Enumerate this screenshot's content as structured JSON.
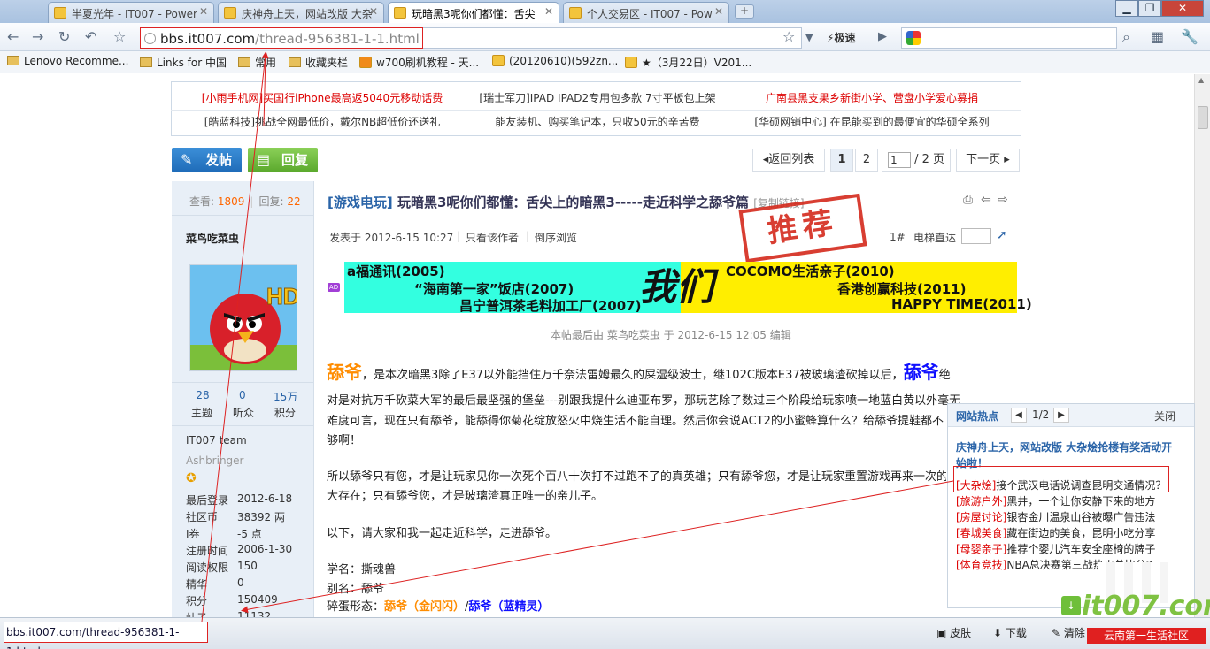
{
  "browser": {
    "tabs": [
      {
        "label": "半夏光年 - IT007 - Power"
      },
      {
        "label": "庆神舟上天，网站改版 大杂"
      },
      {
        "label": "玩暗黑3呢你们都懂：舌尖"
      },
      {
        "label": "个人交易区 - IT007 - Pow"
      }
    ],
    "new_tab": "+",
    "url_host": "bbs.it007.com",
    "url_path": "/thread-956381-1-1.html",
    "speed_label": "极速",
    "bookmarks": [
      "Lenovo Recomme...",
      "Links for 中国",
      "常用",
      "收藏夹栏",
      "w700刷机教程 - 天...",
      "(20120610)(592zn...",
      "★（3月22日）V201..."
    ]
  },
  "ads": [
    "[小雨手机网]买国行iPhone最高返5040元移动话费",
    "[瑞士军刀]IPAD IPAD2专用包多款 7寸平板包上架",
    "广南县黑支果乡新街小学、营盘小学爱心募捐",
    "[皓蓝科技]挑战全网最低价，戴尔NB超低价还送礼",
    "能友装机、购买笔记本，只收50元的辛苦费",
    "[华硕网销中心] 在昆能买到的最便宜的华硕全系列"
  ],
  "actions": {
    "post": "发帖",
    "reply": "回复"
  },
  "pager": {
    "back": "返回列表",
    "p1": "1",
    "p2": "2",
    "current": "1",
    "total": "/ 2 页",
    "next": "下一页"
  },
  "author": {
    "views_label": "查看:",
    "views": "1809",
    "replies_label": "回复:",
    "replies": "22",
    "name": "菜鸟吃菜虫",
    "stats": [
      {
        "value": "28",
        "label": "主题"
      },
      {
        "value": "0",
        "label": "听众"
      },
      {
        "value": "15万",
        "label": "积分"
      }
    ],
    "team": "IT007 team",
    "rank": "Ashbringer",
    "info": [
      {
        "k": "最后登录",
        "v": "2012-6-18"
      },
      {
        "k": "社区币",
        "v": "38392 两"
      },
      {
        "k": "I券",
        "v": "-5 点"
      },
      {
        "k": "注册时间",
        "v": "2006-1-30"
      },
      {
        "k": "阅读权限",
        "v": "150"
      },
      {
        "k": "精华",
        "v": "0"
      },
      {
        "k": "积分",
        "v": "150409"
      },
      {
        "k": "帖子",
        "v": "11132"
      }
    ]
  },
  "post": {
    "tag": "[游戏电玩]",
    "title": "玩暗黑3呢你们都懂：舌尖上的暗黑3-----走近科学之舔爷篇",
    "copy_link": "[复制链接]",
    "posted": "发表于 2012-6-15 10:27",
    "only_author": "只看该作者",
    "reverse": "倒序浏览",
    "floor": "1#",
    "elevator": "电梯直达",
    "stamp": "推荐",
    "edit_note": "本帖最后由 菜鸟吃菜虫 于 2012-6-15 12:05 编辑",
    "banner": {
      "ad_badge": "AD",
      "l1": "a福通讯(2005)",
      "l2": "“海南第一家”饭店(2007)",
      "l3": "昌宁普洱茶毛料加工厂(2007)",
      "mid": "我们",
      "r1": "COCOMO生活亲子(2010)",
      "r2": "香港创赢科技(2011)",
      "r3": "HAPPY TIME(2011)"
    },
    "lick": "舔爷",
    "lick2": "舔爷",
    "p1a": "，是本次暗黑3除了E37以外能挡住万千奈法雷姆最久的屎湿级波士，继102C版本E37被玻璃渣砍掉以后，",
    "p1b": "绝",
    "p2": "对是对抗万千砍菜大军的最后最坚强的堡垒---别跟我提什么迪亚布罗，那玩艺除了数过三个阶段给玩家喷一地蓝白黄以外毫无",
    "p3": "难度可言，现在只有舔爷，能舔得你菊花绽放怒火中烧生活不能自理。然后你会说ACT2的小蜜蜂算什么？给舔爷提鞋都不",
    "p4": "够啊！",
    "p5": "所以舔爷只有您，才是让玩家见你一次死个百八十次打不过跑不了的真英雄；只有舔爷您，才是让玩家重置游戏再来一次的",
    "p6": "大存在；只有舔爷您，才是玻璃渣真正唯一的亲儿子。",
    "p7": "以下，请大家和我一起走近科学，走进舔爷。",
    "p8": "学名：撕魂兽",
    "p9": "别名：舔爷",
    "p10a": "碎蛋形态：",
    "p10b": "舔爷（金闪闪）",
    "p10c": "/",
    "p10d": "舔爷（蓝精灵）"
  },
  "hot": {
    "title": "网站热点",
    "page": "1/2",
    "close": "关闭",
    "headline": "庆神舟上天，网站改版 大杂烩抢楼有奖活动开始啦！",
    "items": [
      {
        "cat": "[大杂烩]",
        "text": "接个武汉电话说调查昆明交通情况？"
      },
      {
        "cat": "[旅游户外]",
        "text": "黑井，一个让你安静下来的地方"
      },
      {
        "cat": "[房屋讨论]",
        "text": "银杏金川温泉山谷被曝广告违法"
      },
      {
        "cat": "[春城美食]",
        "text": "藏在街边的美食，昆明小吃分享"
      },
      {
        "cat": "[母婴亲子]",
        "text": "推荐个婴儿汽车安全座椅的牌子"
      },
      {
        "cat": "[体育竞技]",
        "text": "NBA总决赛第三战热火总比分2:"
      }
    ]
  },
  "status": {
    "url": "bbs.it007.com/thread-956381-1-1.html",
    "skin": "皮肤",
    "download": "下载",
    "clean": "清除",
    "watermark": "it007.com",
    "watermark_sub": "云南第一生活社区"
  },
  "colors": {
    "accent_red": "#d00000",
    "link_blue": "#2a64a8",
    "lick_orange": "#ff8c00",
    "lick_blue": "#1010ff"
  }
}
